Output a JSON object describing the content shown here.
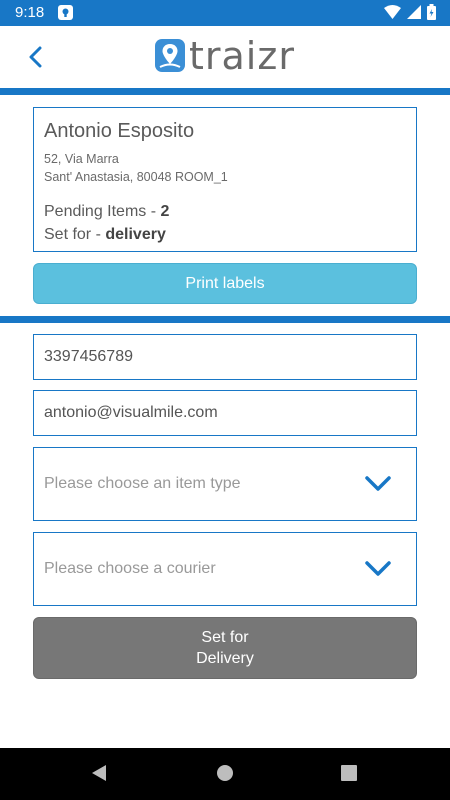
{
  "status_bar": {
    "time": "9:18",
    "icons": [
      "notification-icon",
      "wifi-icon",
      "signal-icon",
      "battery-icon"
    ],
    "color": "#1877c6"
  },
  "header": {
    "logo_text": "traizr",
    "back_icon": "chevron-left-icon"
  },
  "customer": {
    "name": "Antonio Esposito",
    "address_line1": "52, Via Marra",
    "address_line2": "Sant' Anastasia, 80048 ROOM_1",
    "pending_label": "Pending Items - ",
    "pending_count": "2",
    "set_for_label": "Set for - ",
    "set_for_value": "delivery"
  },
  "actions": {
    "print_labels": "Print labels",
    "set_for_delivery_line1": "Set for",
    "set_for_delivery_line2": "Delivery"
  },
  "form": {
    "phone": "3397456789",
    "email": "antonio@visualmile.com",
    "item_type_placeholder": "Please choose an item type",
    "courier_placeholder": "Please choose a courier"
  },
  "colors": {
    "accent": "#1877c6",
    "print_button": "#5bc0de",
    "delivery_button": "#777777"
  }
}
